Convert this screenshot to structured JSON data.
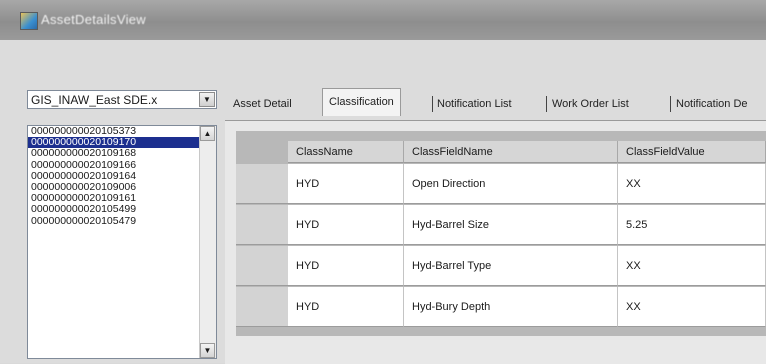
{
  "window": {
    "title": "AssetDetailsView"
  },
  "source_combo": {
    "value": "GIS_INAW_East SDE.x"
  },
  "asset_list": {
    "items": [
      "000000000020105373",
      "000000000020109170",
      "000000000020109168",
      "000000000020109166",
      "000000000020109164",
      "000000000020109006",
      "000000000020109161",
      "000000000020105499",
      "000000000020105479"
    ],
    "selected_index": 1
  },
  "tabs": [
    {
      "label": "Asset Detail"
    },
    {
      "label": "Classification"
    },
    {
      "label": "Notification List"
    },
    {
      "label": "Work Order List"
    },
    {
      "label": "Notification De"
    }
  ],
  "active_tab": 1,
  "grid": {
    "columns": [
      "ClassName",
      "ClassFieldName",
      "ClassFieldValue"
    ],
    "rows": [
      [
        "HYD",
        "Open Direction",
        "XX"
      ],
      [
        "HYD",
        "Hyd-Barrel Size",
        "5.25"
      ],
      [
        "HYD",
        "Hyd-Barrel Type",
        "XX"
      ],
      [
        "HYD",
        "Hyd-Bury Depth",
        "XX"
      ]
    ]
  },
  "colors": {
    "selection": "#1c2f8f",
    "titlebar": "#9a9a9a"
  }
}
